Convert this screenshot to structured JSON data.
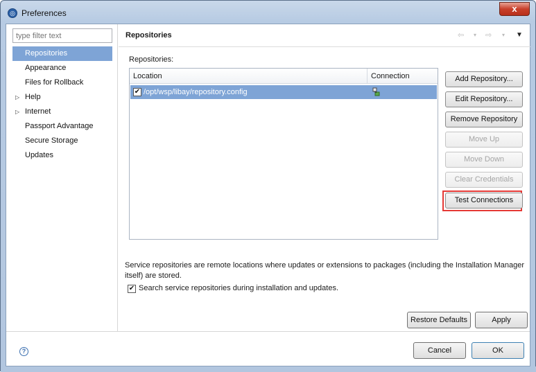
{
  "window": {
    "title": "Preferences",
    "close_glyph": "x"
  },
  "filter": {
    "placeholder": "type filter text"
  },
  "tree": [
    {
      "label": "Repositories",
      "expandable": false,
      "selected": true
    },
    {
      "label": "Appearance",
      "expandable": false,
      "selected": false
    },
    {
      "label": "Files for Rollback",
      "expandable": false,
      "selected": false
    },
    {
      "label": "Help",
      "expandable": true,
      "selected": false
    },
    {
      "label": "Internet",
      "expandable": true,
      "selected": false
    },
    {
      "label": "Passport Advantage",
      "expandable": false,
      "selected": false
    },
    {
      "label": "Secure Storage",
      "expandable": false,
      "selected": false
    },
    {
      "label": "Updates",
      "expandable": false,
      "selected": false
    }
  ],
  "header": {
    "title": "Repositories",
    "nav_icons": [
      "back-arrow-icon",
      "dropdown-icon",
      "forward-arrow-icon",
      "dropdown-icon",
      "view-menu-icon"
    ]
  },
  "repositories": {
    "label": "Repositories:",
    "columns": [
      "Location",
      "Connection"
    ],
    "rows": [
      {
        "checked": true,
        "location": "/opt/wsp/libay/repository.config",
        "connection_icon": "connection-icon"
      }
    ]
  },
  "side_buttons": [
    {
      "label": "Add Repository...",
      "enabled": true
    },
    {
      "label": "Edit Repository...",
      "enabled": true
    },
    {
      "label": "Remove Repository",
      "enabled": true
    },
    {
      "label": "Move Up",
      "enabled": false
    },
    {
      "label": "Move Down",
      "enabled": false
    },
    {
      "label": "Clear Credentials",
      "enabled": false
    },
    {
      "label": "Test Connections",
      "enabled": true,
      "highlighted": true
    }
  ],
  "description": "Service repositories are remote locations where updates or extensions to packages (including the Installation Manager itself) are stored.",
  "search_option": {
    "checked": true,
    "label": "Search service repositories during installation and updates."
  },
  "page_buttons": {
    "restore": "Restore Defaults",
    "apply": "Apply"
  },
  "dialog_buttons": {
    "cancel": "Cancel",
    "ok": "OK"
  },
  "colors": {
    "selection": "#7ea4d6",
    "highlight_border": "#e53935"
  }
}
